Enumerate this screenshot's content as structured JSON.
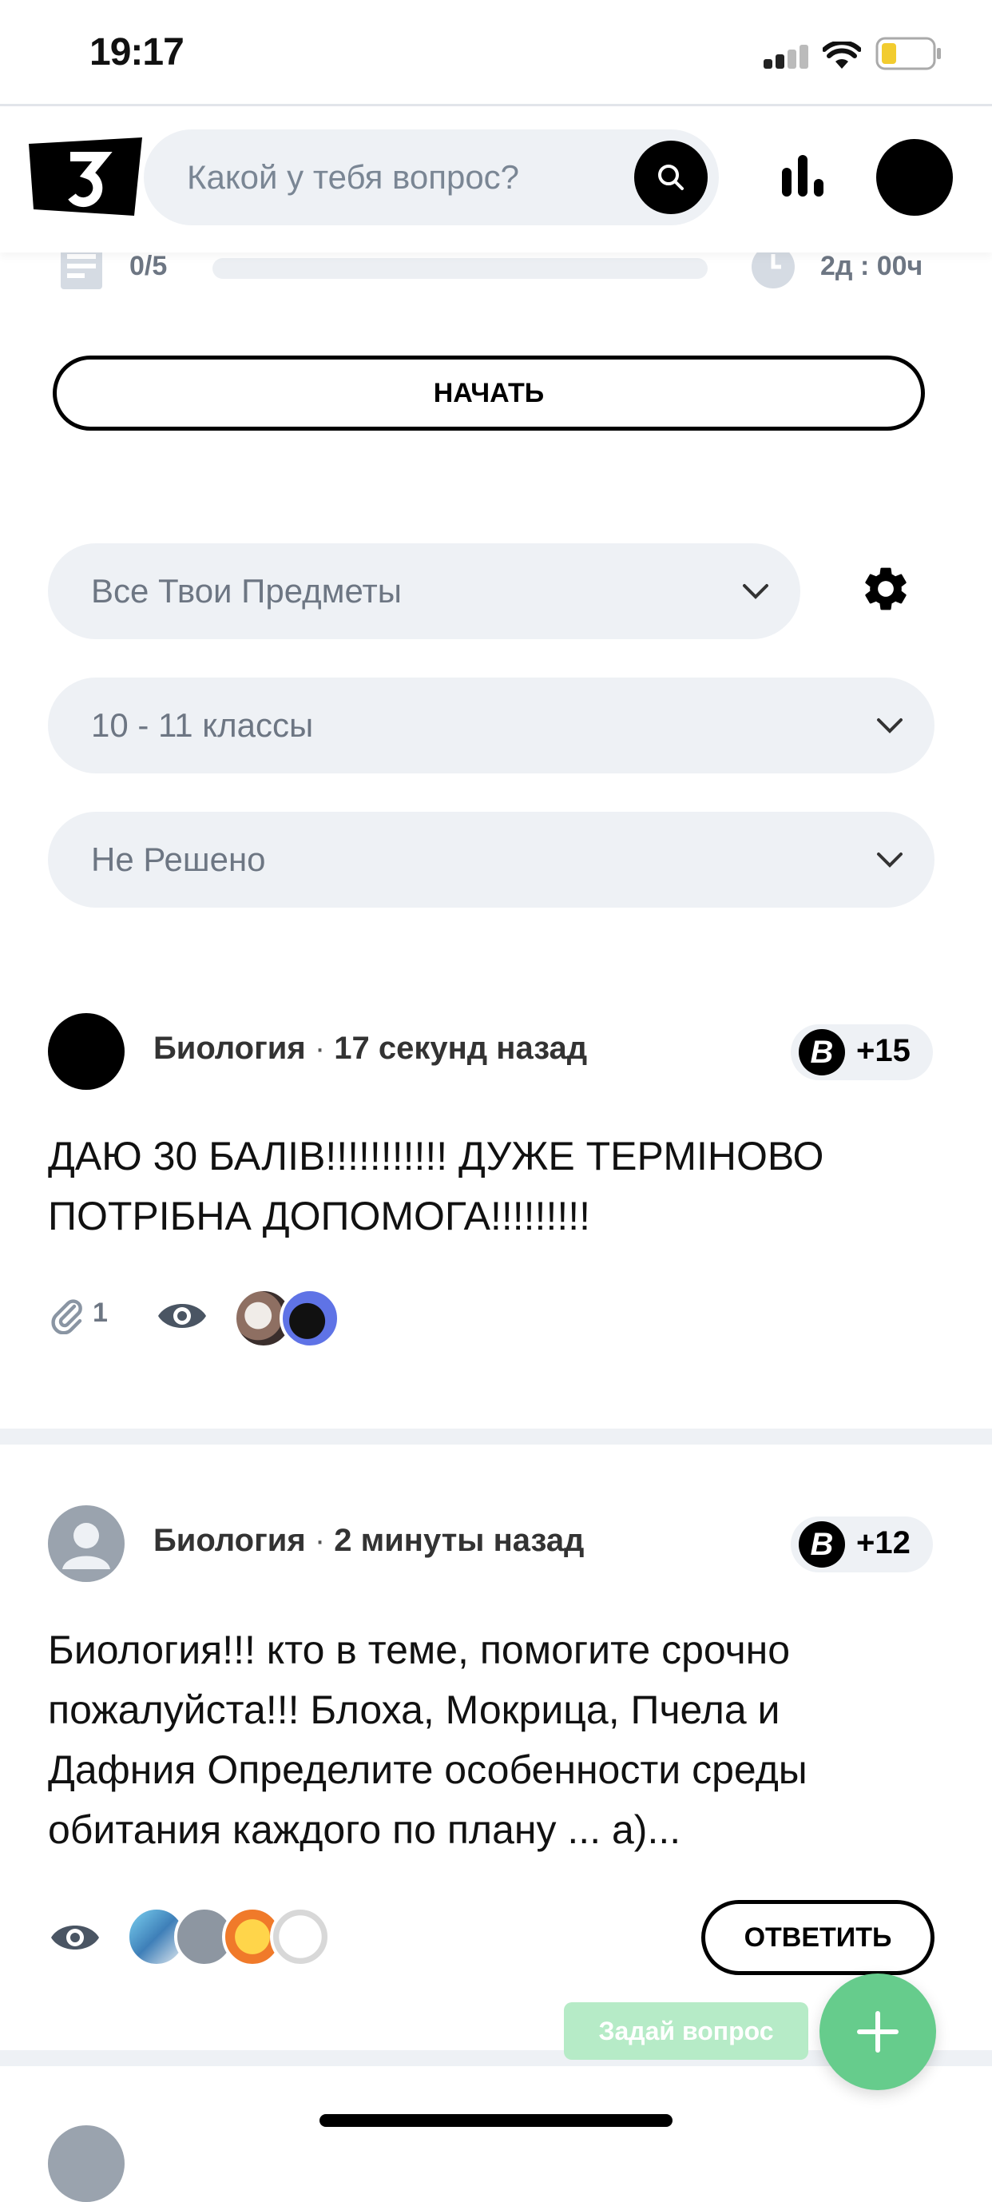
{
  "status_bar": {
    "time": "19:17"
  },
  "header": {
    "search_placeholder": "Какой у тебя вопрос?"
  },
  "progress": {
    "count": "0/5",
    "fill": 0.0,
    "timer": "2д : 00ч",
    "start_label": "НАЧАТЬ"
  },
  "filters": {
    "subjects": "Все Твои Предметы",
    "grade": "10 - 11 классы",
    "status": "Не Решено"
  },
  "questions": [
    {
      "subject": "Биология",
      "separator": "·",
      "time": "17 секунд назад",
      "points": "+15",
      "points_badge": "B",
      "text": "ДАЮ 30 БАЛІВ!!!!!!!!!!! ДУЖЕ ТЕРМІНОВО ПОТРІБНА ДОПОМОГА!!!!!!!!!",
      "attachments": "1"
    },
    {
      "subject": "Биология",
      "separator": "·",
      "time": "2 минуты назад",
      "points": "+12",
      "points_badge": "B",
      "text": "Биология!!! кто в теме, помогите срочно пожалуйста!!! Блоха, Мокрица, Пчела и Дафния Определите особенности среды обитания каждого по плану ... а)...",
      "answer_label": "ОТВЕТИТЬ"
    }
  ],
  "fab": {
    "tooltip": "Задай вопрос",
    "icon": "plus-icon"
  },
  "colors": {
    "accent_green": "#66cc8c",
    "pill_bg": "#eef1f5",
    "muted_text": "#6d7683"
  }
}
